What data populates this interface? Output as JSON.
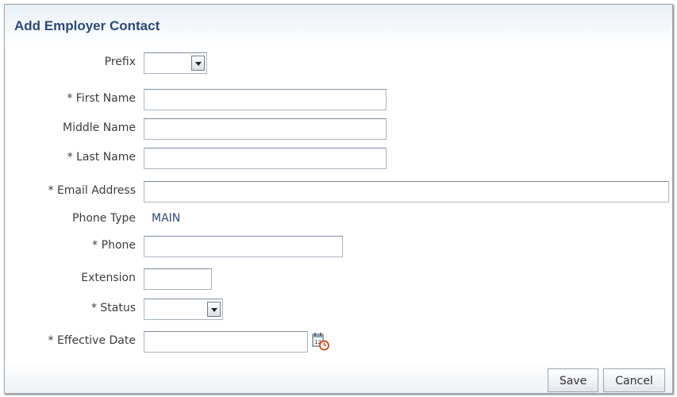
{
  "dialog": {
    "title": "Add Employer Contact"
  },
  "fields": {
    "prefix": {
      "label": "Prefix",
      "value": ""
    },
    "first_name": {
      "label": "* First Name",
      "value": ""
    },
    "middle_name": {
      "label": "Middle Name",
      "value": ""
    },
    "last_name": {
      "label": "* Last Name",
      "value": ""
    },
    "email": {
      "label": "* Email Address",
      "value": ""
    },
    "phone_type": {
      "label": "Phone Type",
      "value": "MAIN"
    },
    "phone": {
      "label": "* Phone",
      "value": ""
    },
    "extension": {
      "label": "Extension",
      "value": ""
    },
    "status": {
      "label": "* Status",
      "value": ""
    },
    "effective_date": {
      "label": "* Effective Date",
      "value": "",
      "icon": "calendar-clock-icon"
    }
  },
  "actions": {
    "save_label": "Save",
    "cancel_label": "Cancel"
  },
  "colors": {
    "title": "#2b4a77",
    "label": "#3c3c3c",
    "field_border": "#a9b5c1"
  }
}
